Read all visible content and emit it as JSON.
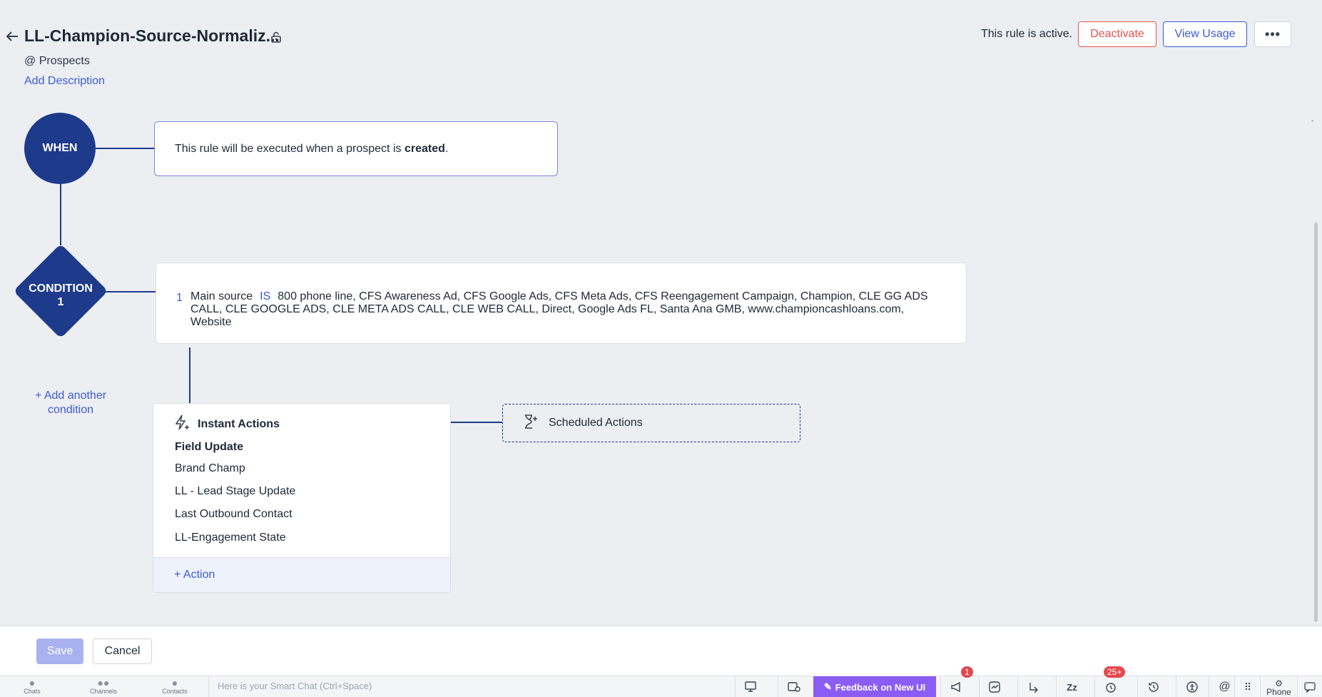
{
  "header": {
    "title": "LL-Champion-Source-Normaliz...",
    "module": "@ Prospects",
    "add_description": "Add Description",
    "status_text": "This rule is active.",
    "deactivate": "Deactivate",
    "view_usage": "View Usage",
    "more": "•••"
  },
  "flow": {
    "when_label": "WHEN",
    "when_text_prefix": "This rule will be executed when a prospect is",
    "when_text_bold": "created",
    "when_text_suffix": ".",
    "condition_label_line1": "CONDITION",
    "condition_label_line2": "1",
    "condition": {
      "number": "1",
      "field": "Main source",
      "operator": "IS",
      "values": "800 phone line, CFS Awareness Ad, CFS Google Ads, CFS Meta Ads, CFS Reengagement Campaign, Champion, CLE GG ADS CALL, CLE GOOGLE ADS, CLE META ADS CALL, CLE WEB CALL, Direct, Google Ads FL, Santa Ana GMB, www.championcashloans.com, Website"
    },
    "add_condition": "+ Add another condition",
    "instant_actions": {
      "title": "Instant Actions",
      "group": "Field Update",
      "items": [
        "Brand Champ",
        "LL - Lead Stage Update",
        "Last Outbound Contact",
        "LL-Engagement State"
      ],
      "add_action": "+ Action"
    },
    "scheduled_actions": "Scheduled Actions"
  },
  "footer": {
    "save": "Save",
    "cancel": "Cancel"
  },
  "bottombar": {
    "tabs": [
      "Chats",
      "Channels",
      "Contacts"
    ],
    "smart_chat_placeholder": "Here is your Smart Chat (Ctrl+Space)",
    "feedback": "Feedback on New UI",
    "announcements_badge": "1",
    "reminders_badge": "25+",
    "phone": "Phone"
  },
  "colors": {
    "accent": "#3b5bd6",
    "node": "#1e3a8a",
    "danger": "#e5534b",
    "feedback": "#8b5cf6"
  }
}
